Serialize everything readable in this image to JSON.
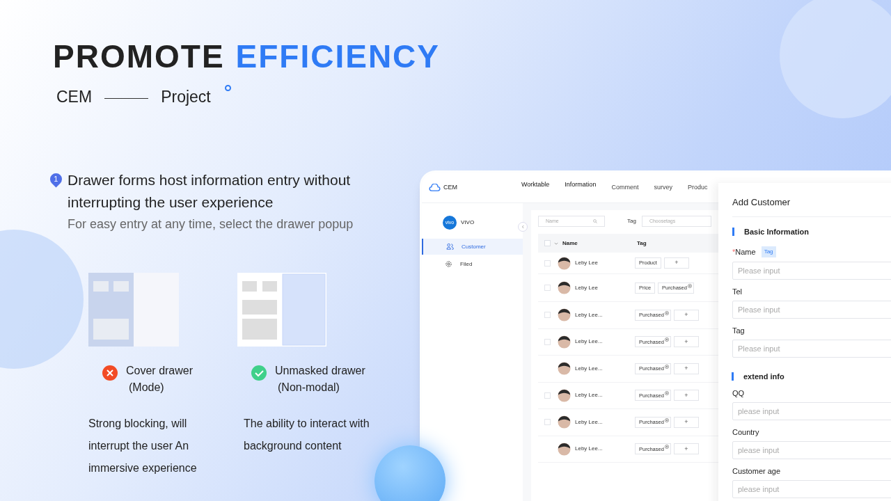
{
  "headline": {
    "words": [
      "PROMOTE",
      "EFFICIENCY"
    ],
    "subtitle_left": "CEM",
    "subtitle_right": "Project"
  },
  "point": {
    "number": "1",
    "heading": "Drawer forms host information entry without interrupting the user experience",
    "subheading": "For easy entry at any time, select the drawer popup"
  },
  "options": [
    {
      "kind": "bad",
      "label_lines": [
        "Cover drawer",
        "(Mode)"
      ],
      "description": "Strong blocking, will interrupt the user An immersive experience"
    },
    {
      "kind": "good",
      "label_lines": [
        "Unmasked drawer",
        "(Non-modal)"
      ],
      "description": "The ability to interact with background content"
    }
  ],
  "app": {
    "logo": "CEM",
    "nav": [
      "Worktable",
      "Information",
      "Comment",
      "survey",
      "Produc"
    ],
    "org": {
      "badge": "vivo",
      "name": "VIVO"
    },
    "sidebar": [
      {
        "label": "Customer",
        "selected": true
      },
      {
        "label": "Filed",
        "selected": false
      }
    ],
    "filters": {
      "name_placeholder": "Name",
      "tag_label": "Tag",
      "tag_placeholder": "Choosetags"
    },
    "columns": [
      "Name",
      "Tag"
    ],
    "header_checked": false,
    "rows": [
      {
        "checked": false,
        "name": "Leby Lee",
        "tags": [
          {
            "kind": "tag",
            "text": "Product"
          },
          {
            "kind": "add",
            "text": "+"
          }
        ]
      },
      {
        "checked": false,
        "name": "Leby Lee",
        "tags": [
          {
            "kind": "tag",
            "text": "Price"
          },
          {
            "kind": "removable",
            "text": "Purchased"
          }
        ]
      },
      {
        "checked": false,
        "name": "Leby Lee...",
        "tags": [
          {
            "kind": "removable",
            "text": "Purchased"
          },
          {
            "kind": "add",
            "text": "+"
          }
        ]
      },
      {
        "checked": false,
        "name": "Leby Lee...",
        "tags": [
          {
            "kind": "removable",
            "text": "Purchased"
          },
          {
            "kind": "add",
            "text": "+"
          }
        ]
      },
      {
        "name": "Leby Lee...",
        "tags": [
          {
            "kind": "removable",
            "text": "Purchased"
          },
          {
            "kind": "add",
            "text": "+"
          }
        ]
      },
      {
        "checked": false,
        "name": "Leby Lee...",
        "tags": [
          {
            "kind": "removable",
            "text": "Purchased"
          },
          {
            "kind": "add",
            "text": "+"
          }
        ]
      },
      {
        "checked": false,
        "name": "Leby Lee...",
        "tags": [
          {
            "kind": "removable",
            "text": "Purchased"
          },
          {
            "kind": "add",
            "text": "+"
          }
        ]
      },
      {
        "name": "Leby Lee...",
        "tags": [
          {
            "kind": "removable",
            "text": "Purchased"
          },
          {
            "kind": "add",
            "text": "+"
          }
        ]
      }
    ],
    "drawer": {
      "title": "Add Customer",
      "sections": [
        {
          "title": "Basic Information",
          "fields": [
            {
              "required_mark": "*",
              "label": "Name",
              "badge": "Tag",
              "placeholder": "Please input"
            },
            {
              "label": "Tel",
              "placeholder": "Please input"
            },
            {
              "label": "Tag",
              "placeholder": "Please input"
            }
          ]
        },
        {
          "title": "extend info",
          "fields": [
            {
              "label": "QQ",
              "placeholder": "please input"
            },
            {
              "label": "Country",
              "placeholder": "please input"
            },
            {
              "label": "Customer age",
              "placeholder": "please input"
            }
          ]
        }
      ]
    }
  }
}
